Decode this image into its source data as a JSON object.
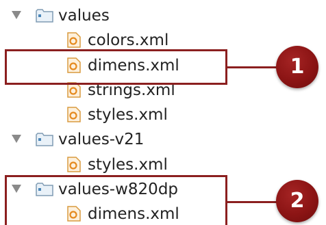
{
  "tree": {
    "rows": [
      {
        "type": "folder",
        "label": "values"
      },
      {
        "type": "file",
        "label": "colors.xml"
      },
      {
        "type": "file",
        "label": "dimens.xml"
      },
      {
        "type": "file",
        "label": "strings.xml"
      },
      {
        "type": "file",
        "label": "styles.xml"
      },
      {
        "type": "folder",
        "label": "values-v21"
      },
      {
        "type": "file",
        "label": "styles.xml"
      },
      {
        "type": "folder",
        "label": "values-w820dp"
      },
      {
        "type": "file",
        "label": "dimens.xml"
      }
    ]
  },
  "callouts": [
    {
      "number": "1"
    },
    {
      "number": "2"
    }
  ],
  "colors": {
    "callout": "#8b1f1f",
    "folder_icon": "#b9d3e6",
    "file_icon": "#f4a43a",
    "disclosure": "#8a8a8a"
  },
  "icons": {
    "folder": "folder-icon",
    "file": "xml-file-icon",
    "expand": "disclosure-triangle-icon"
  }
}
